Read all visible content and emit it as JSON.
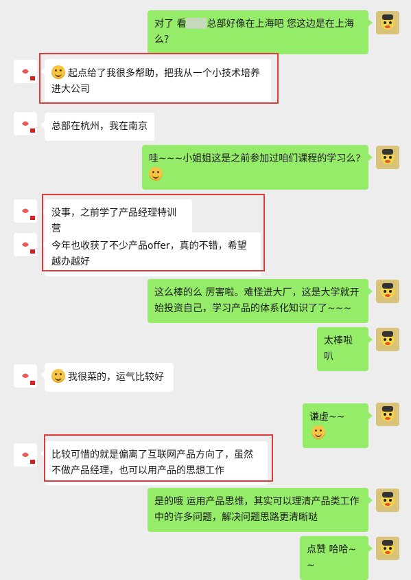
{
  "chat": {
    "messages": [
      {
        "side": "right",
        "parts": [
          {
            "t": "text",
            "v": "对了 看"
          },
          {
            "t": "blur"
          },
          {
            "t": "text",
            "v": "总部好像在上海吧 您这边是在上海么？"
          }
        ]
      },
      {
        "side": "left",
        "parts": [
          {
            "t": "emoji",
            "v": "crying-laughing-emoji"
          },
          {
            "t": "text",
            "v": "起点给了我很多帮助，把我从一个小技术培养进大公司"
          }
        ]
      },
      {
        "side": "left",
        "parts": [
          {
            "t": "text",
            "v": "总部在杭州，我在南京"
          }
        ]
      },
      {
        "side": "right",
        "parts": [
          {
            "t": "text",
            "v": "哇~~~小姐姐这是之前参加过咱们课程的学习么?"
          },
          {
            "t": "emoji",
            "v": "thinking-emoji"
          }
        ]
      },
      {
        "side": "left",
        "parts": [
          {
            "t": "text",
            "v": "没事，之前学了产品经理特训营"
          }
        ]
      },
      {
        "side": "left",
        "parts": [
          {
            "t": "text",
            "v": "今年也收获了不少产品offer，真的不错，希望越办越好"
          }
        ]
      },
      {
        "side": "right",
        "parts": [
          {
            "t": "text",
            "v": "这么棒的么  厉害啦。难怪进大厂，这是大学就开始投资自己，学习产品的体系化知识了了~~~"
          }
        ]
      },
      {
        "side": "right",
        "parts": [
          {
            "t": "text",
            "v": "太棒啦叭"
          }
        ]
      },
      {
        "side": "left",
        "parts": [
          {
            "t": "emoji",
            "v": "crying-laughing-emoji"
          },
          {
            "t": "text",
            "v": "我很菜的，运气比较好"
          }
        ]
      },
      {
        "side": "right",
        "parts": [
          {
            "t": "text",
            "v": "谦虚~~"
          },
          {
            "t": "emoji",
            "v": "shy-smile-emoji"
          }
        ]
      },
      {
        "side": "left",
        "parts": [
          {
            "t": "text",
            "v": "比较可惜的就是偏离了互联网产品方向了，虽然不做产品经理，也可以用产品的思想工作"
          }
        ]
      },
      {
        "side": "right",
        "parts": [
          {
            "t": "text",
            "v": "是的哦  运用产品思维，其实可以理清产品类工作中的许多问题，解决问题思路更清晰哒"
          }
        ]
      },
      {
        "side": "right",
        "parts": [
          {
            "t": "text",
            "v": "点赞 哈哈~~"
          }
        ]
      }
    ]
  },
  "colors": {
    "background": "#ededed",
    "self_bubble": "#95ec69",
    "other_bubble": "#ffffff",
    "highlight_box": "#e03a3a"
  }
}
